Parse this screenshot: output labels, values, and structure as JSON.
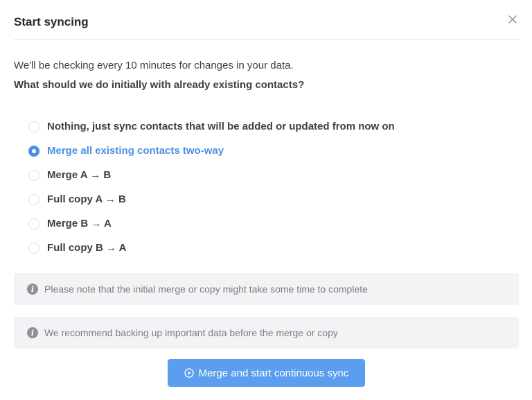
{
  "dialog": {
    "title": "Start syncing",
    "close_icon": "close-icon"
  },
  "intro": "We'll be checking every 10 minutes for changes in your data.",
  "question": "What should we do initially with already existing contacts?",
  "options": [
    {
      "label": "Nothing, just sync contacts that will be added or updated from now on",
      "selected": false
    },
    {
      "label": "Merge all existing contacts two-way",
      "selected": true
    },
    {
      "label": "Merge A → B",
      "selected": false
    },
    {
      "label": "Full copy A → B",
      "selected": false
    },
    {
      "label": "Merge B → A",
      "selected": false
    },
    {
      "label": "Full copy B → A",
      "selected": false
    }
  ],
  "notes": [
    {
      "icon": "info-icon",
      "glyph": "i",
      "text": "Please note that the initial merge or copy might take some time to complete"
    },
    {
      "icon": "info-icon",
      "glyph": "i",
      "text": "We recommend backing up important data before the merge or copy"
    }
  ],
  "primary_button": {
    "label": "Merge and start continuous sync",
    "icon": "play-circle-icon"
  },
  "colors": {
    "accent": "#4a90e2",
    "button": "#5b9dee",
    "note_bg": "#f2f3f5"
  }
}
